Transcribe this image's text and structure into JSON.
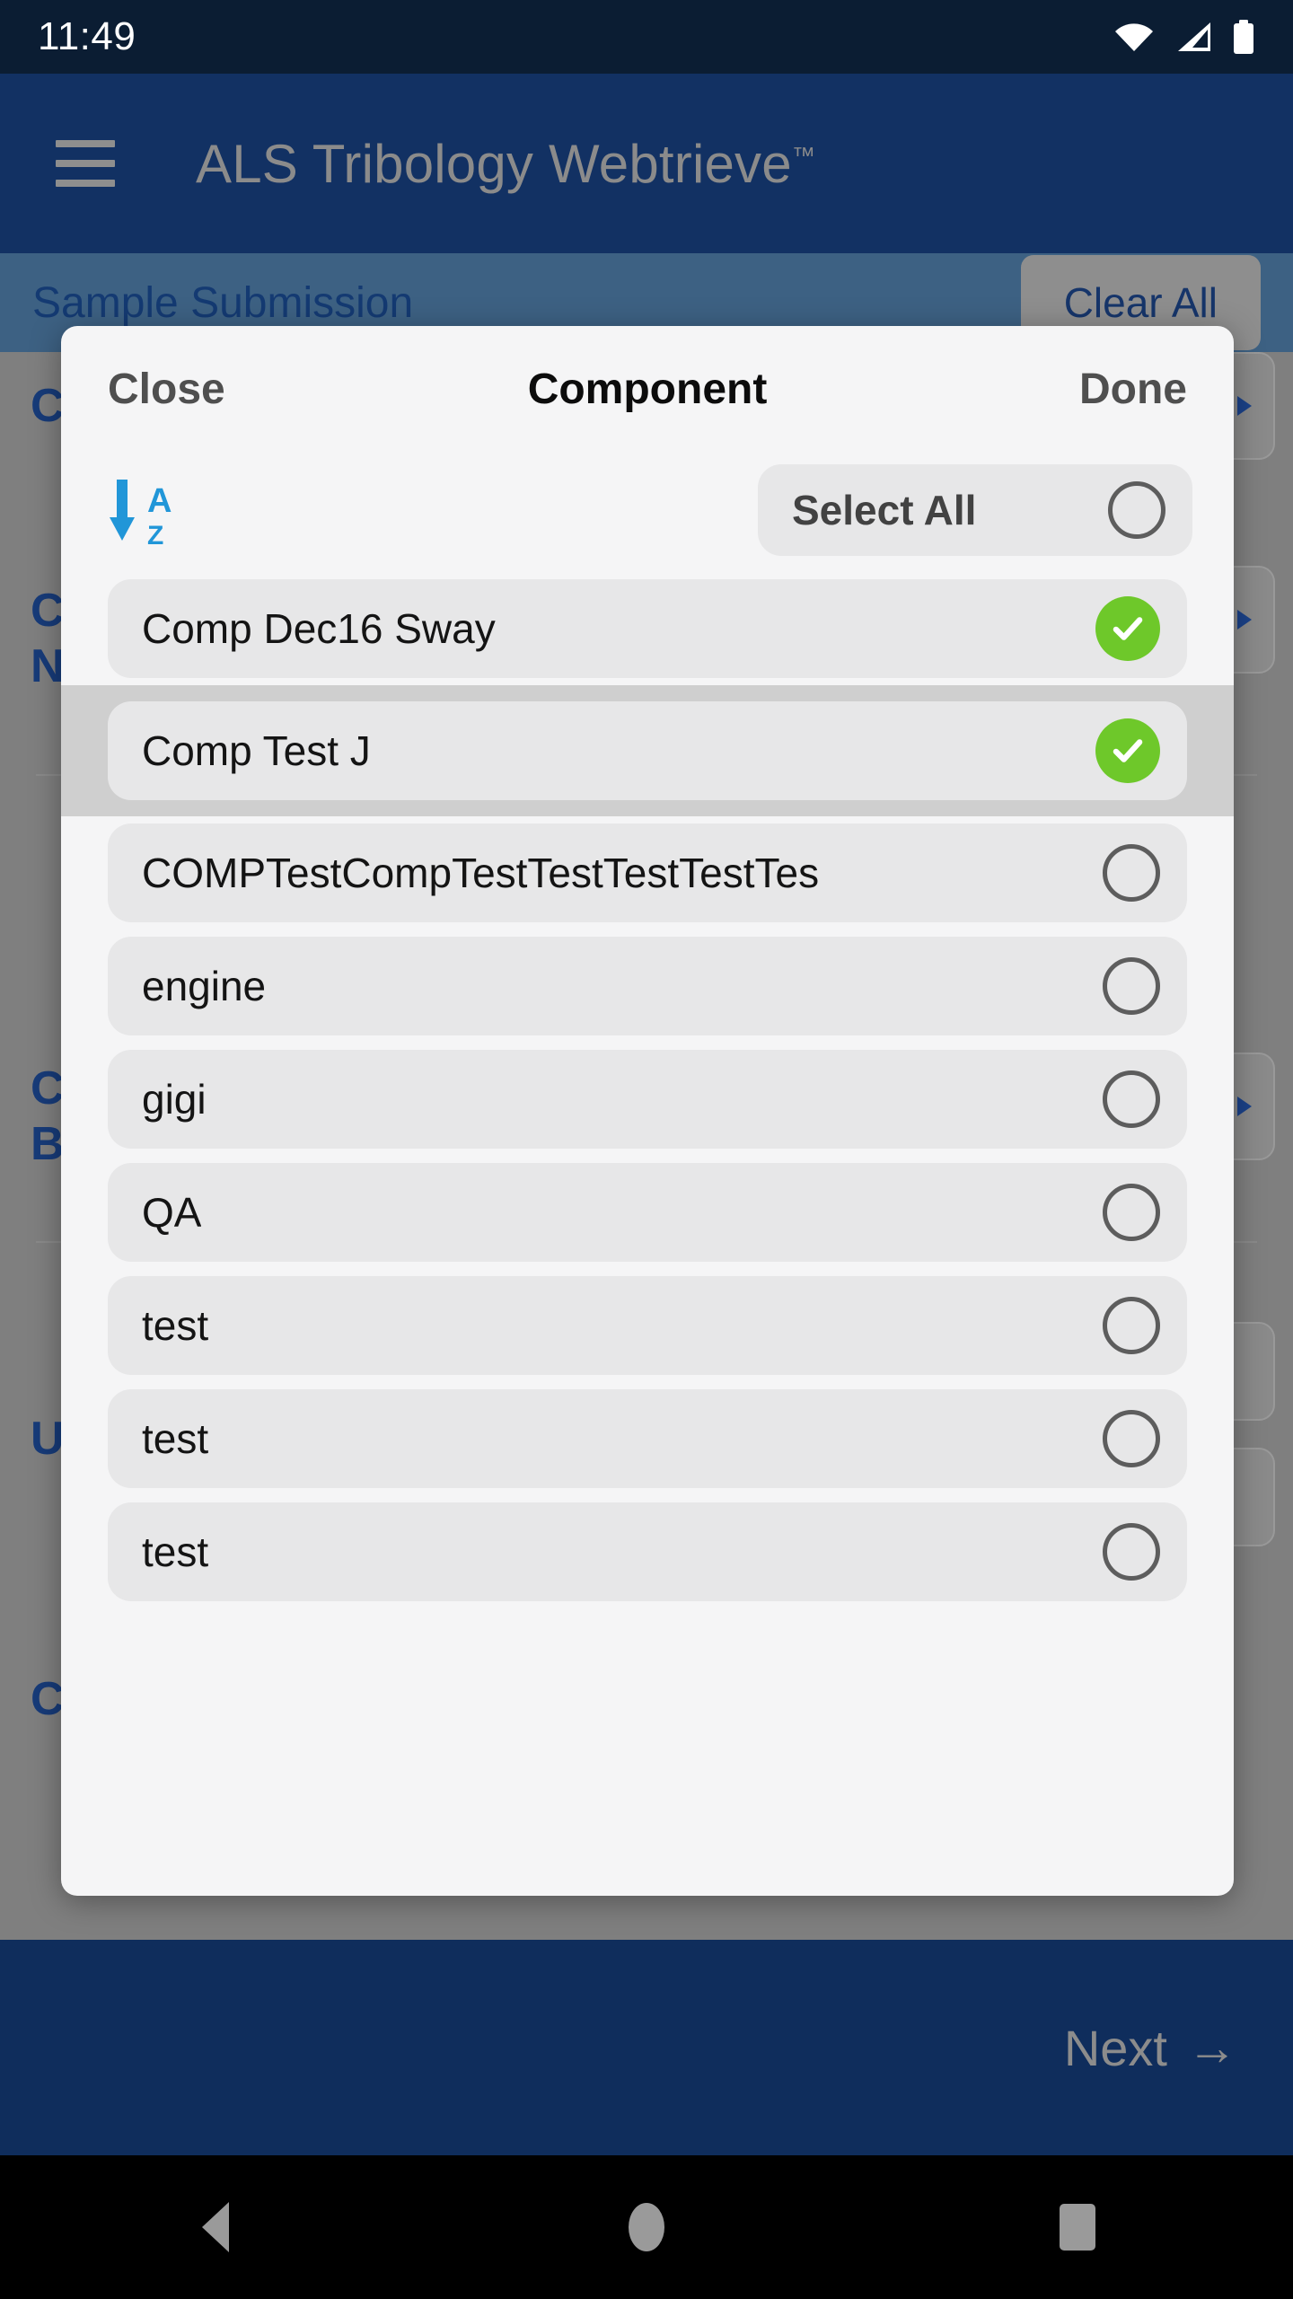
{
  "status_bar": {
    "time": "11:49",
    "icons": [
      "wifi-icon",
      "cellular-signal-icon",
      "battery-icon"
    ]
  },
  "app_bar": {
    "menu_icon": "hamburger-menu-icon",
    "title": "ALS Tribology Webtrieve",
    "trademark": "™"
  },
  "sub_bar": {
    "title": "Sample Submission",
    "clear_all_label": "Clear All"
  },
  "background_form": {
    "fields": [
      {
        "label": "C"
      },
      {
        "label": "C"
      },
      {
        "label": "N"
      },
      {
        "label": "C"
      },
      {
        "label": "B"
      },
      {
        "label": "U"
      },
      {
        "label": "C"
      }
    ]
  },
  "modal": {
    "close_label": "Close",
    "title": "Component",
    "done_label": "Done",
    "sort_icon": "sort-alpha-ascending-icon",
    "sort_letters": {
      "top": "A",
      "bottom": "Z"
    },
    "select_all_label": "Select All",
    "select_all_checked": false,
    "items": [
      {
        "label": "Comp Dec16 Sway",
        "checked": true,
        "highlighted": false
      },
      {
        "label": "Comp Test J",
        "checked": true,
        "highlighted": true
      },
      {
        "label": "COMPTestCompTestTestTestTestTes",
        "checked": false,
        "highlighted": false
      },
      {
        "label": "engine",
        "checked": false,
        "highlighted": false
      },
      {
        "label": "gigi",
        "checked": false,
        "highlighted": false
      },
      {
        "label": "QA",
        "checked": false,
        "highlighted": false
      },
      {
        "label": "test",
        "checked": false,
        "highlighted": false
      },
      {
        "label": "test",
        "checked": false,
        "highlighted": false
      },
      {
        "label": "test",
        "checked": false,
        "highlighted": false
      }
    ]
  },
  "bottom_bar": {
    "next_label": "Next",
    "next_arrow": "→"
  },
  "nav_bar": {
    "back": "back-icon",
    "home": "home-icon",
    "recents": "recents-icon"
  },
  "colors": {
    "status_bar_bg": "#0b1d33",
    "app_bar_bg": "#123163",
    "sub_bar_bg": "#3d6183",
    "modal_bg": "#f5f5f6",
    "item_bg": "#e7e7e8",
    "highlight_bg": "#cfcfcf",
    "check_green": "#6ec82a",
    "sort_blue": "#2196d8",
    "bottom_bar_bg": "#0f2d5c",
    "scrim": "#7f7f7f"
  }
}
